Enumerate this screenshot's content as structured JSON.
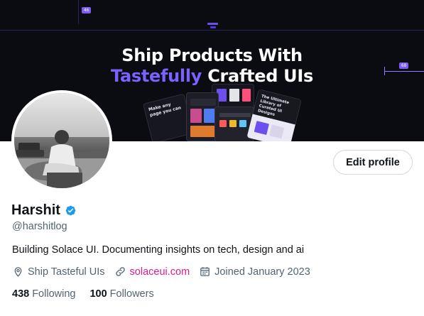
{
  "banner": {
    "headline_line1": "Ship Products With",
    "headline_highlight": "Tastefully",
    "headline_rest": " Crafted UIs",
    "measure_tag_top": "46",
    "measure_tag_right": "68",
    "accent_color": "#7b61ff",
    "mock_texts": {
      "a": "Make any page you can",
      "d": "The Ultimate Library of Curated UI Designs"
    }
  },
  "profile": {
    "edit_button_label": "Edit profile",
    "display_name": "Harshit",
    "verified_icon": "verified-badge-icon",
    "handle": "@harshitlog",
    "bio": "Building Solace UI. Documenting insights on tech, design and ai",
    "location": "Ship Tasteful UIs",
    "website": "solaceui.com",
    "joined": "Joined January 2023",
    "following_count": "438",
    "following_label": "Following",
    "followers_count": "100",
    "followers_label": "Followers",
    "link_color": "#e11a8b",
    "verified_color": "#1d9bf0"
  }
}
